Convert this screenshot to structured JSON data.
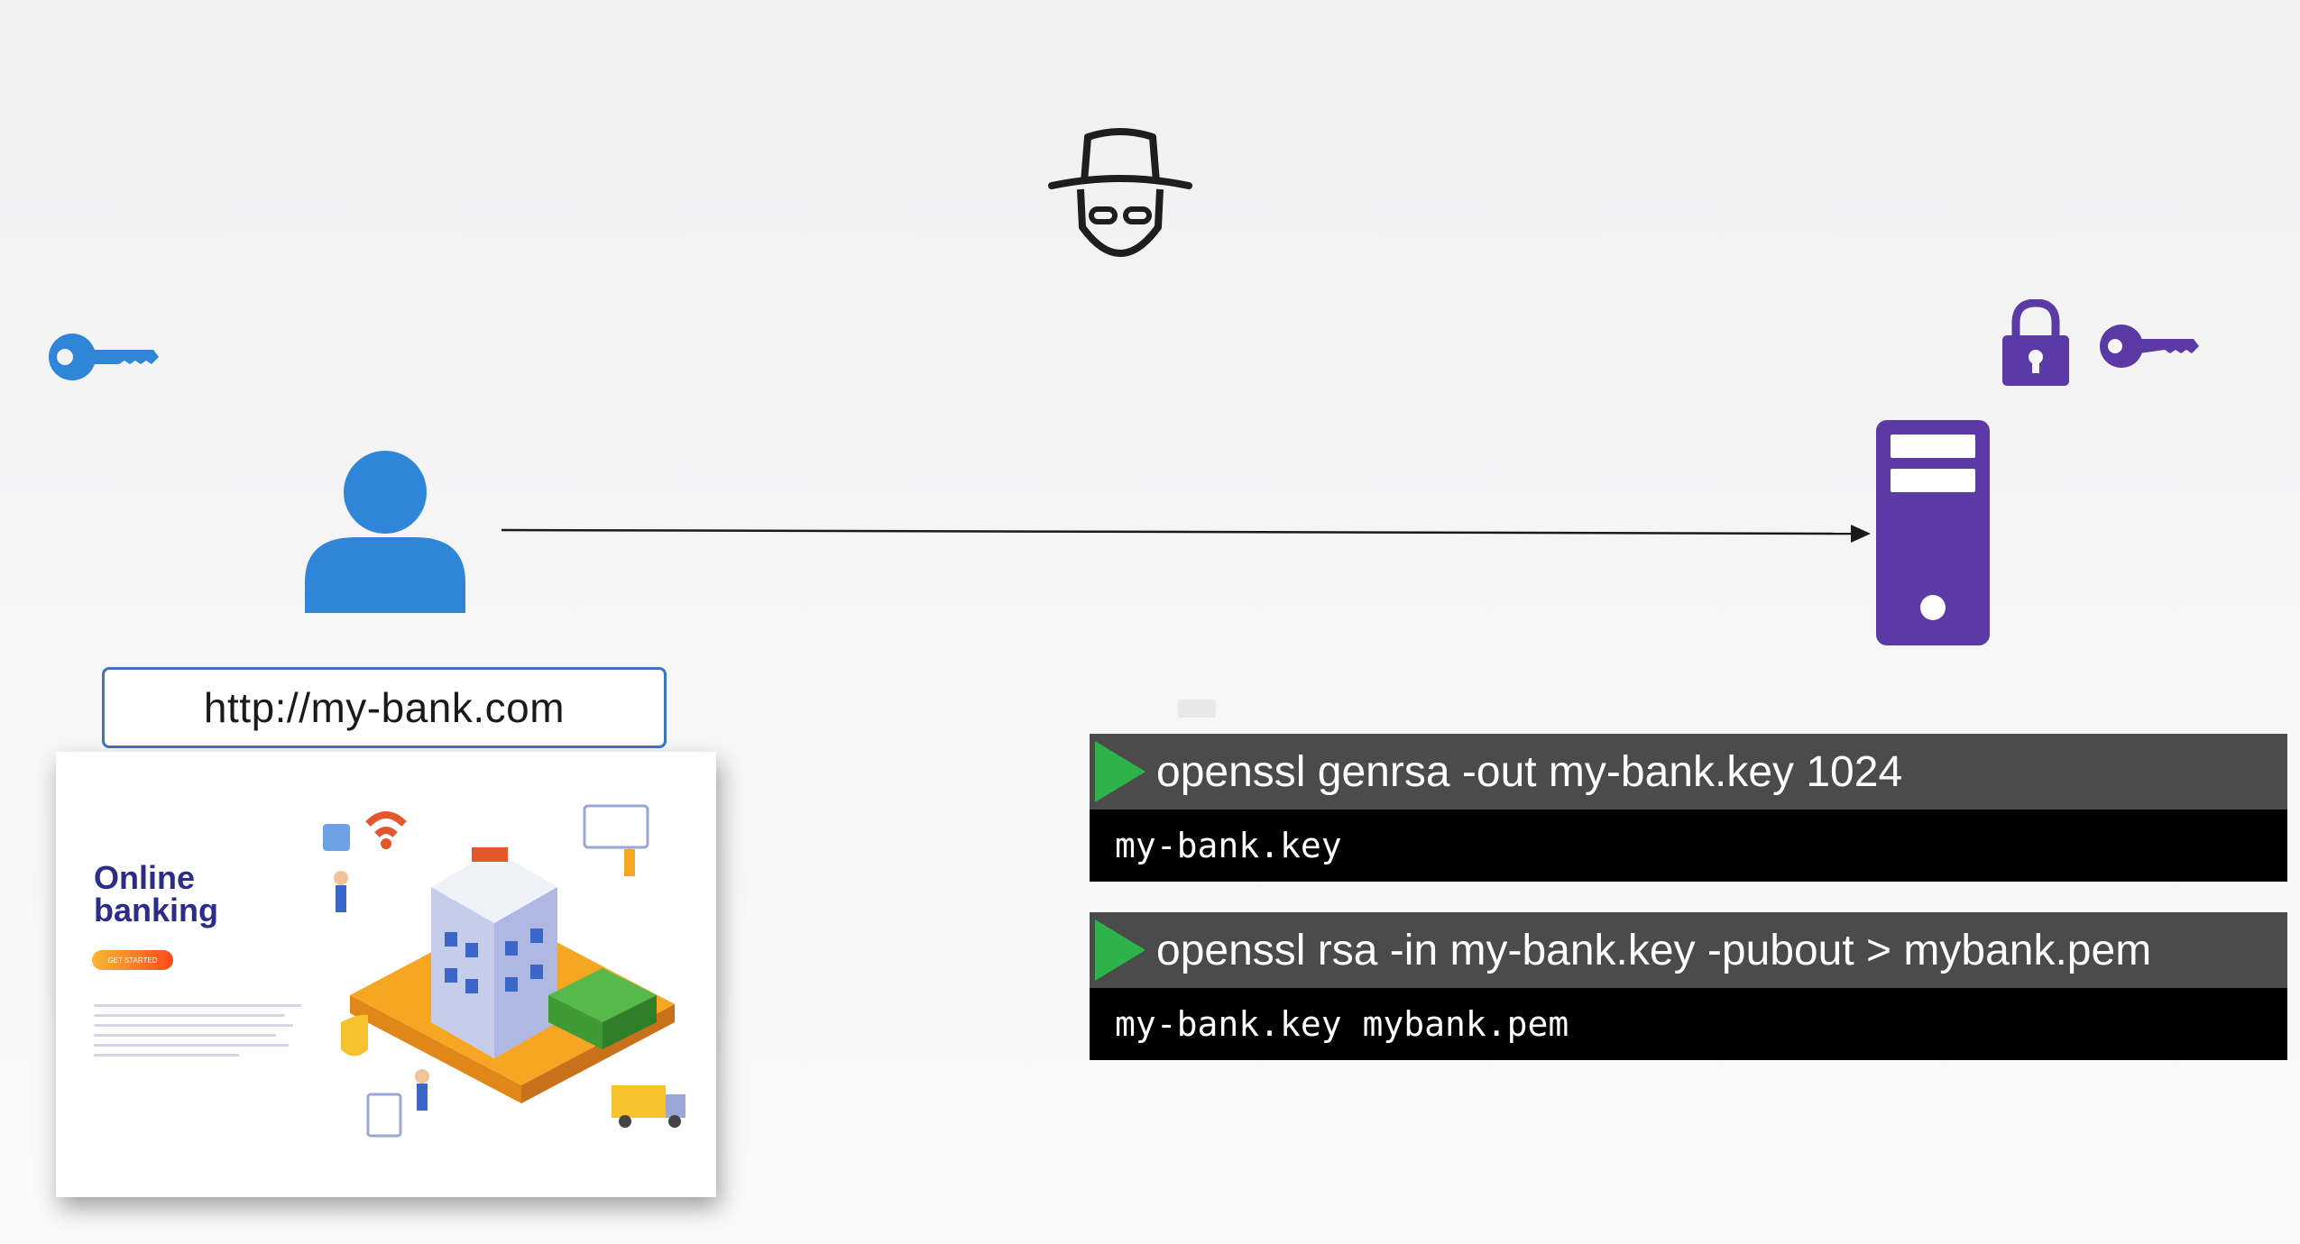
{
  "url_bar": {
    "text": "http://my-bank.com"
  },
  "bank_card": {
    "title_line1": "Online",
    "title_line2": "banking",
    "button_label": "GET STARTED"
  },
  "commands": [
    {
      "command": "openssl genrsa -out my-bank.key 1024",
      "output": "my-bank.key"
    },
    {
      "command": "openssl rsa -in my-bank.key -pubout > mybank.pem",
      "output": "my-bank.key mybank.pem"
    }
  ],
  "icons": {
    "hacker": "hacker-icon",
    "client_key": "key-icon",
    "server_lock": "lock-icon",
    "server_key": "key-icon",
    "user": "user-icon",
    "server": "server-icon"
  },
  "colors": {
    "client_blue": "#2f86d8",
    "server_purple": "#5b3aa6",
    "play_green": "#2db34a",
    "command_bar": "#4b4b4b",
    "output_bar": "#000000"
  }
}
